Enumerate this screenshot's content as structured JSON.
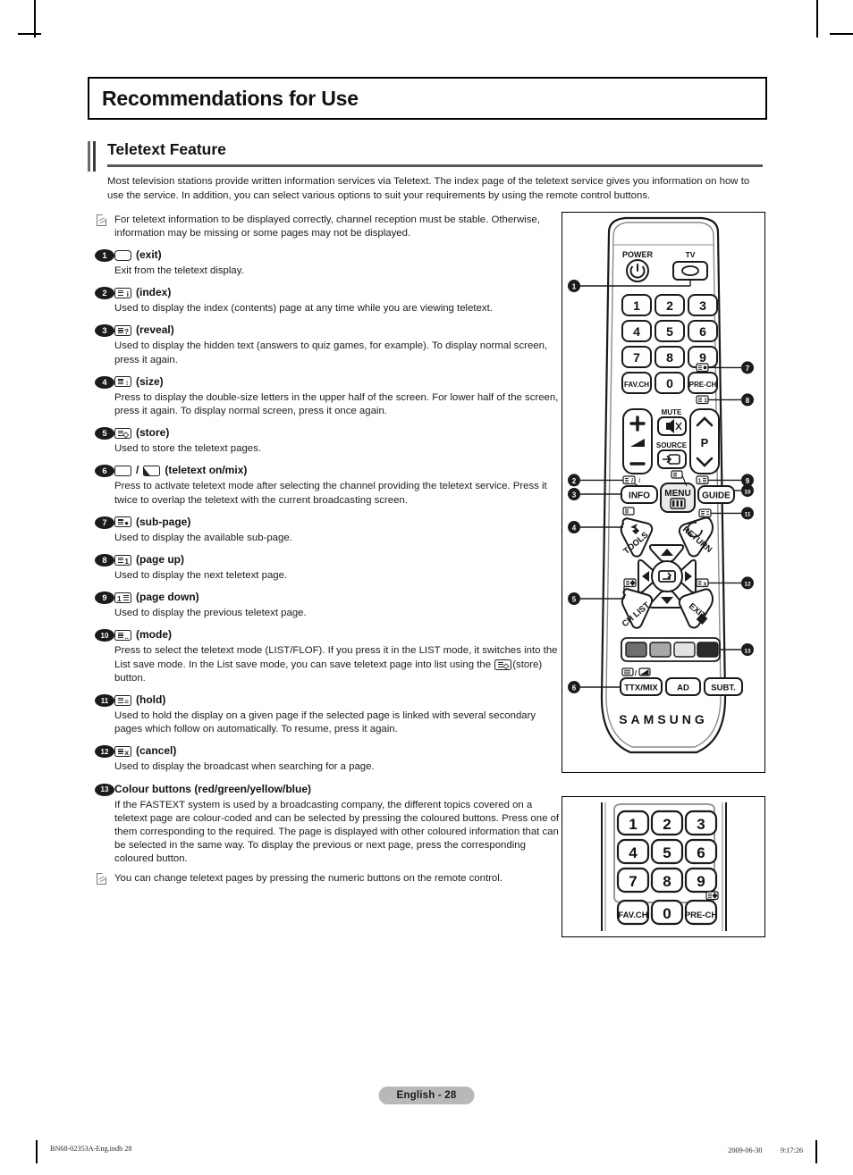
{
  "chapter": {
    "title": "Recommendations for Use"
  },
  "section": {
    "title": "Teletext Feature"
  },
  "intro": "Most television stations provide written information services via Teletext. The index page of the teletext service gives you information on how to use the service. In addition, you can select various options to suit your requirements by using the remote control buttons.",
  "notes": {
    "top": "For teletext information to be displayed correctly, channel reception must be stable. Otherwise, information may be missing or some pages may not be displayed.",
    "bottom": "You can change teletext pages by pressing the numeric buttons on the remote control."
  },
  "items": [
    {
      "num": "1",
      "icon": "teletext-exit-icon",
      "label": "(exit)",
      "body": "Exit from the teletext display."
    },
    {
      "num": "2",
      "icon": "teletext-index-icon",
      "label": "(index)",
      "body": "Used to display the index (contents) page at any time while you are viewing teletext."
    },
    {
      "num": "3",
      "icon": "teletext-reveal-icon",
      "label": "(reveal)",
      "body": "Used to display the hidden text (answers to quiz games, for example). To display normal screen, press it again."
    },
    {
      "num": "4",
      "icon": "teletext-size-icon",
      "label": "(size)",
      "body": "Press to display the double-size letters in the upper half of the screen. For lower half of the screen, press it again. To display normal screen, press it once again."
    },
    {
      "num": "5",
      "icon": "teletext-store-icon",
      "label": "(store)",
      "body": "Used to store the teletext pages."
    },
    {
      "num": "6",
      "icon": "teletext-onmix-icon",
      "label": "(teletext on/mix)",
      "body": "Press to activate teletext mode after selecting the channel providing the teletext service. Press it twice to overlap the teletext with the current broadcasting screen."
    },
    {
      "num": "7",
      "icon": "teletext-subpage-icon",
      "label": "(sub-page)",
      "body": "Used to display the available sub-page."
    },
    {
      "num": "8",
      "icon": "teletext-pageup-icon",
      "label": "(page up)",
      "body": "Used to display the next teletext page."
    },
    {
      "num": "9",
      "icon": "teletext-pagedown-icon",
      "label": "(page down)",
      "body": "Used to display the previous teletext page."
    },
    {
      "num": "10",
      "icon": "teletext-mode-icon",
      "label": "(mode)",
      "body_pre": "Press to select the teletext mode (LIST/FLOF). If you press it in the LIST mode, it switches into the List save mode. In the List save mode, you can save teletext page into list using the ",
      "body_post": "(store) button."
    },
    {
      "num": "11",
      "icon": "teletext-hold-icon",
      "label": "(hold)",
      "body": "Used to hold the display on a given page if the selected page is linked with several secondary pages which follow on automatically. To resume, press it again."
    },
    {
      "num": "12",
      "icon": "teletext-cancel-icon",
      "label": "(cancel)",
      "body": "Used to display the broadcast when searching for a page."
    },
    {
      "num": "13",
      "icon": "none",
      "label": "Colour buttons (red/green/yellow/blue)",
      "body": "If the FASTEXT system is used by a broadcasting company, the different topics covered on a teletext page are colour-coded and can be selected by pressing the coloured buttons. Press one of them corresponding to the required. The page is displayed with other coloured information that can be selected in the same way. To display the previous or next page, press the corresponding coloured button."
    }
  ],
  "remote": {
    "brand": "SAMSUNG",
    "power_label": "POWER",
    "tv_label": "TV",
    "mute_label": "MUTE",
    "source_label": "SOURCE",
    "p_label": "P",
    "numbers": [
      "1",
      "2",
      "3",
      "4",
      "5",
      "6",
      "7",
      "8",
      "9"
    ],
    "zero": "0",
    "fav_ch": "FAV.CH",
    "pre_ch": "PRE-CH",
    "info": "INFO",
    "menu": "MENU",
    "guide": "GUIDE",
    "tools": "TOOLS",
    "return": "RETURN",
    "ch_list": "CH LIST",
    "exit": "EXIT",
    "ttx_mix": "TTX/MIX",
    "ad": "AD",
    "subt": "SUBT.",
    "callouts": [
      "1",
      "2",
      "3",
      "4",
      "5",
      "6",
      "7",
      "8",
      "9",
      "10",
      "11",
      "12",
      "13"
    ],
    "colour_buttons": [
      "#6f6f6f",
      "#a8a8a8",
      "#e2e2e2",
      "#2b2b2b"
    ]
  },
  "keypad": {
    "numbers": [
      "1",
      "2",
      "3",
      "4",
      "5",
      "6",
      "7",
      "8",
      "9"
    ],
    "zero": "0",
    "fav_ch": "FAV.CH",
    "pre_ch": "PRE-CH"
  },
  "footer": {
    "page_badge": "English - 28",
    "file_ref": "BN68-02353A-Eng.indb   28",
    "timestamp": "2009-06-30   　　 9:17:26"
  }
}
